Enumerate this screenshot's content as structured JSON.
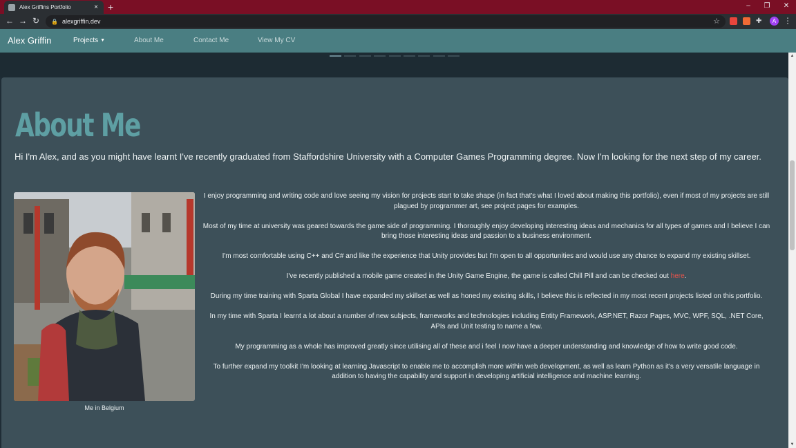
{
  "browser": {
    "tab_title": "Alex Griffins Portfolio",
    "tab_close": "×",
    "new_tab": "+",
    "url": "alexgriffin.dev",
    "avatar_initial": "A",
    "window_controls": {
      "minimize": "–",
      "restore": "❐",
      "close": "✕"
    },
    "nav_buttons": {
      "back": "←",
      "forward": "→",
      "reload": "↻"
    },
    "bookmark_star": "☆",
    "menu": "⋮",
    "lock": "🔒"
  },
  "navbar": {
    "brand": "Alex Griffin",
    "links": [
      "Projects",
      "About Me",
      "Contact Me",
      "View My CV"
    ],
    "active_index": 0
  },
  "carousel": {
    "indicator_count": 9,
    "active_index": 0
  },
  "about": {
    "heading": "About Me",
    "intro": "Hi I'm Alex, and as you might have learnt I've recently graduated from Staffordshire University with a Computer Games Programming degree. Now I'm looking for the next step of my career.",
    "photo_caption": "Me in Belgium",
    "paragraphs": [
      "I enjoy programming and writing code and love seeing my vision for projects start to take shape (in fact that's what I loved about making this portfolio), even if most of my projects are still plagued by programmer art, see project pages for examples.",
      "Most of my time at university was geared towards the game side of programming. I thoroughly enjoy developing interesting ideas and mechanics for all types of games and I believe I can bring those interesting ideas and passion to a business environment.",
      "I'm most comfortable using C++ and C# and like the experience that Unity provides but I'm open to all opportunities and would use any chance to expand my existing skillset.",
      "During my time training with Sparta Global I have expanded my skillset as well as honed my existing skills, I believe this is reflected in my most recent projects listed on this portfolio.",
      "In my time with Sparta I learnt a lot about a number of new subjects, frameworks and technologies including Entity Framework, ASP.NET, Razor Pages, MVC, WPF, SQL, .NET Core, APIs and Unit testing to name a few.",
      "My programming as a whole has improved greatly since utilising all of these and i feel I now have a deeper understanding and knowledge of how to write good code.",
      "To further expand my toolkit I'm looking at learning Javascript to enable me to accomplish more within web development, as well as learn Python as it's a very versatile language in addition to having the capability and support in developing artificial intelligence and machine learning."
    ],
    "published_text": "I've recently published a mobile game created in the Unity Game Engine, the game is called Chill Pill and can be checked out ",
    "published_link": "here",
    "published_end": "."
  },
  "colors": {
    "navbar": "#4a7e82",
    "heading": "#5e9fa3",
    "card": "#3d5059",
    "link": "#e7534b",
    "tabstrip": "#7a0f25"
  }
}
